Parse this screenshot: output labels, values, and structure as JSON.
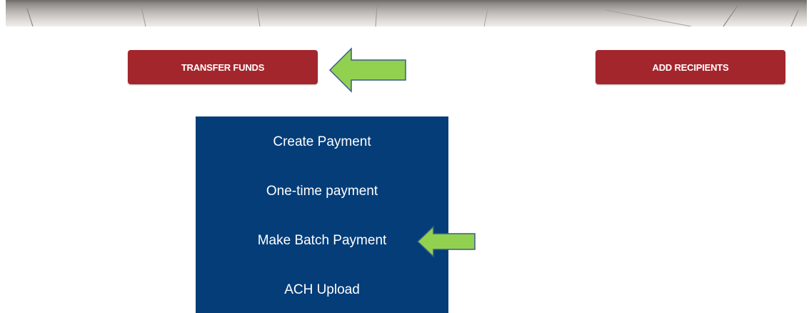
{
  "buttons": {
    "transfer_funds": "TRANSFER FUNDS",
    "add_recipients": "ADD RECIPIENTS"
  },
  "dropdown": {
    "items": [
      {
        "label": "Create Payment"
      },
      {
        "label": "One-time payment"
      },
      {
        "label": "Make Batch Payment"
      },
      {
        "label": "ACH Upload"
      }
    ]
  },
  "annotations": {
    "arrows": [
      {
        "target": "transfer_funds",
        "direction": "left",
        "icon": "left-arrow-icon"
      },
      {
        "target": "make_batch_payment",
        "direction": "left",
        "icon": "left-arrow-icon"
      }
    ]
  },
  "colors": {
    "button_red": "#a3262c",
    "menu_blue": "#043d78",
    "arrow_green": "#92d050",
    "arrow_outline": "#3a5a8c",
    "text_white": "#ffffff"
  }
}
